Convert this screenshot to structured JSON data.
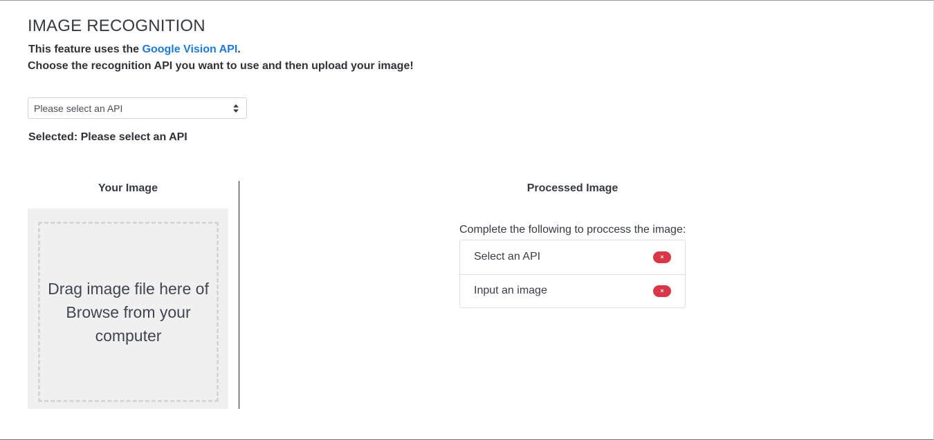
{
  "header": {
    "title": "IMAGE RECOGNITION",
    "intro_prefix": "This feature uses the ",
    "intro_link": "Google Vision API",
    "intro_suffix": ".",
    "instructions": "Choose the recognition API you want to use and then upload your image!"
  },
  "api_select": {
    "value": "Please select an API",
    "icon": "select-arrows-icon"
  },
  "selected": {
    "text": "Selected: Please select an API"
  },
  "left_panel": {
    "title": "Your Image",
    "dropzone_text": "Drag image file here of Browse from your computer"
  },
  "right_panel": {
    "title": "Processed Image",
    "caption": "Complete the following to proccess the image:",
    "items": [
      {
        "label": "Select an API",
        "status": "×"
      },
      {
        "label": "Input an image",
        "status": "×"
      }
    ]
  },
  "colors": {
    "link": "#1a7ae6",
    "danger": "#dc3545",
    "dropzone_bg": "#f0f0f0"
  }
}
